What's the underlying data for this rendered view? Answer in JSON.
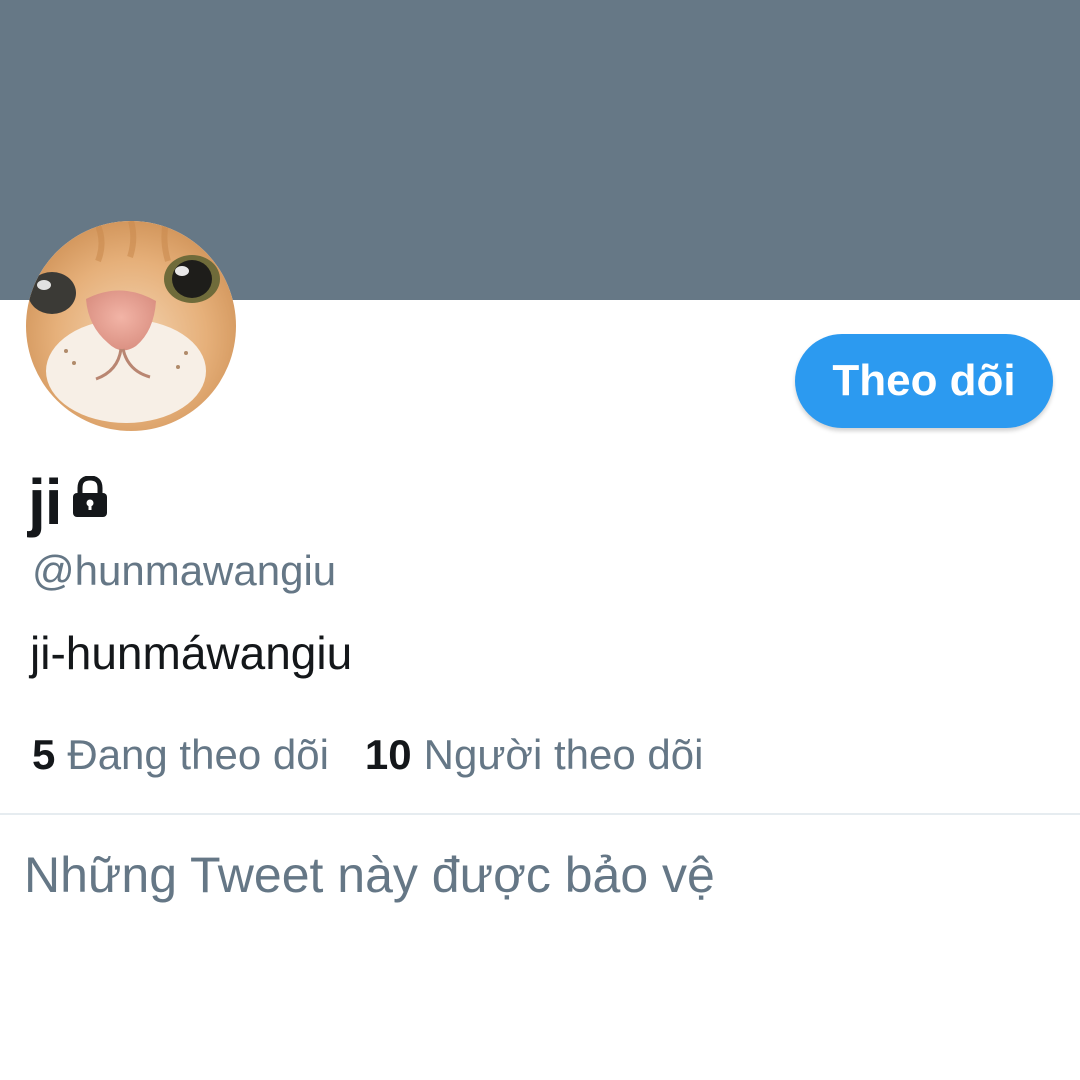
{
  "profile": {
    "display_name": "ji",
    "handle": "@hunmawangiu",
    "bio": "ji-hunmáwangiu",
    "locked_icon": "lock-icon",
    "avatar_icon": "cat-face-avatar"
  },
  "actions": {
    "follow_label": "Theo dõi"
  },
  "stats": {
    "following_count": "5",
    "following_label": "Đang theo dõi",
    "followers_count": "10",
    "followers_label": "Người theo dõi"
  },
  "content": {
    "protected_message": "Những Tweet này được bảo vệ"
  },
  "colors": {
    "banner": "#667886",
    "accent": "#2c9af0",
    "primary_text": "#14171a",
    "secondary_text": "#657786"
  }
}
